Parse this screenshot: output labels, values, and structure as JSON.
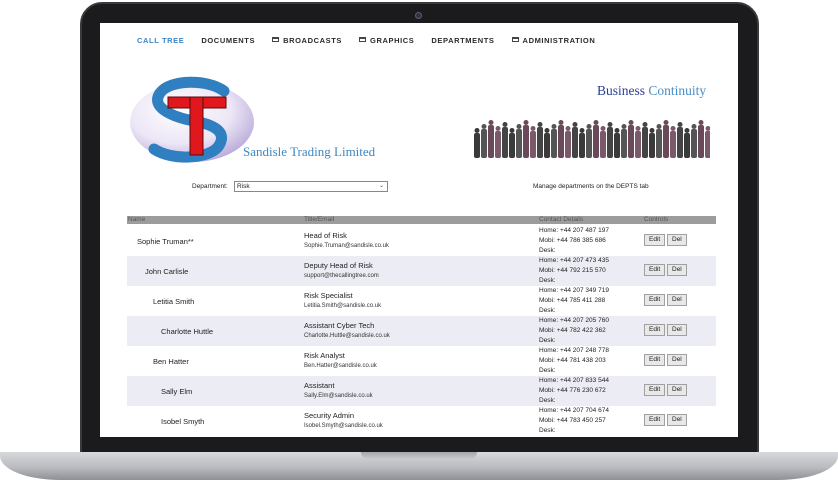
{
  "nav": {
    "items": [
      {
        "label": "CALL TREE",
        "active": true,
        "icon": ""
      },
      {
        "label": "DOCUMENTS",
        "active": false,
        "icon": ""
      },
      {
        "label": "BROADCASTS",
        "active": false,
        "icon": "folder-icon"
      },
      {
        "label": "GRAPHICS",
        "active": false,
        "icon": "folder-icon"
      },
      {
        "label": "DEPARTMENTS",
        "active": false,
        "icon": ""
      },
      {
        "label": "ADMINISTRATION",
        "active": false,
        "icon": "folder-icon"
      }
    ]
  },
  "header": {
    "company_name": "Sandisle Trading Limited",
    "bc_word1": "Business",
    "bc_word2": "Continuity"
  },
  "department": {
    "label": "Department:",
    "selected": "Risk",
    "note": "Manage departments on the DEPTS tab"
  },
  "table": {
    "headers": {
      "name": "Name",
      "title": "Title/Email",
      "contact": "Contact Details",
      "controls": "Controls"
    },
    "edit_label": "Edit",
    "del_label": "Del",
    "rows": [
      {
        "name": "Sophie Truman**",
        "title": "Head of Risk",
        "email": "Sophie.Truman@sandisle.co.uk",
        "home": "Home: +44 207 487 197",
        "mobi": "Mobi: +44 786 385 686",
        "desk": "Desk:"
      },
      {
        "name": "John Carlisle",
        "title": "Deputy Head of Risk",
        "email": "support@thecallingtree.com",
        "home": "Home: +44 207 473 435",
        "mobi": "Mobi: +44 792 215 570",
        "desk": "Desk:"
      },
      {
        "name": "Letitia Smith",
        "title": "Risk Specialist",
        "email": "Letitia.Smith@sandisle.co.uk",
        "home": "Home: +44 207 349 719",
        "mobi": "Mobi: +44 785 411 288",
        "desk": "Desk:"
      },
      {
        "name": "Charlotte Huttle",
        "title": "Assistant Cyber Tech",
        "email": "Charlotte.Huttle@sandisle.co.uk",
        "home": "Home: +44 207 205 760",
        "mobi": "Mobi: +44 782 422 362",
        "desk": "Desk:"
      },
      {
        "name": "Ben Hatter",
        "title": "Risk Analyst",
        "email": "Ben.Hatter@sandisle.co.uk",
        "home": "Home: +44 207 248 778",
        "mobi": "Mobi: +44 781 438 203",
        "desk": "Desk:"
      },
      {
        "name": "Sally Elm",
        "title": "Assistant",
        "email": "Sally.Elm@sandisle.co.uk",
        "home": "Home: +44 207 833 544",
        "mobi": "Mobi: +44 776 230 672",
        "desk": "Desk:"
      },
      {
        "name": "Isobel Smyth",
        "title": "Security Admin",
        "email": "Isobel.Smyth@sandisle.co.uk",
        "home": "Home: +44 207 704 674",
        "mobi": "Mobi: +44 783 450 257",
        "desk": "Desk:"
      }
    ]
  },
  "colors": {
    "accent": "#3b86c8",
    "header_bar": "#9c9c9c",
    "alt_row": "#ececf4",
    "logo_red": "#e0181e",
    "logo_blue": "#2f7fc1"
  }
}
